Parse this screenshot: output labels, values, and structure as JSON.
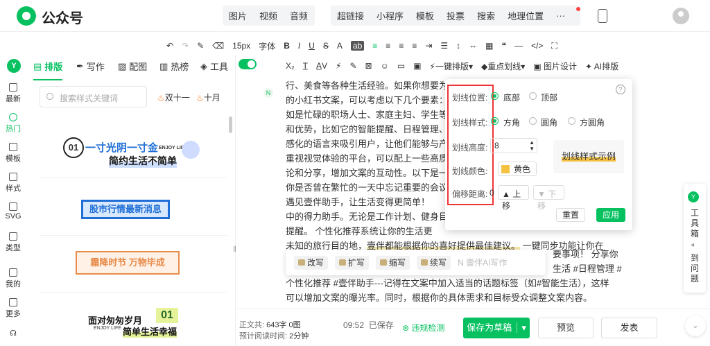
{
  "brand": {
    "title": "公众号"
  },
  "top_nav": {
    "group1": [
      "图片",
      "视频",
      "音频"
    ],
    "group2": [
      "超链接",
      "小程序",
      "模板",
      "投票",
      "搜索",
      "地理位置",
      "···"
    ]
  },
  "toolbar1": [
    "15px",
    "字体",
    "B",
    "I",
    "U",
    "S",
    "A",
    "ab",
    "≡",
    "A",
    "¶",
    "</>"
  ],
  "toolbar2": {
    "oneclick": "一键排版",
    "underline": "重点划线",
    "image_design": "图片设计",
    "ai": "AI排版"
  },
  "left_panel": {
    "tabs": [
      "排版",
      "写作",
      "配图",
      "热榜",
      "工具"
    ],
    "search_placeholder": "搜索样式关键词",
    "hot_tags": [
      "双十一",
      "十月"
    ],
    "templates": {
      "t1": {
        "num": "01",
        "main": "一寸光阴一寸金",
        "sub": "简约生活不简单",
        "tag": "ENJOY LIFE"
      },
      "t2": {
        "text": "股市行情最新消息"
      },
      "t3": {
        "text": "霜降时节 万物毕成"
      },
      "t4": {
        "main": "面对匆匆岁月",
        "num": "01",
        "sub": "简单生活幸福",
        "tag": "ENJOY LIFE"
      }
    }
  },
  "sidebar": [
    {
      "label": "最新"
    },
    {
      "label": "热门"
    },
    {
      "label": "模板"
    },
    {
      "label": "样式"
    },
    {
      "label": "SVG"
    },
    {
      "label": "类型"
    },
    {
      "label": "我的"
    },
    {
      "label": "更多"
    }
  ],
  "editor": {
    "lines": [
      "行、美食等各种生活经验。如果你想要为",
      "的小红书文案，可以考虑以下几个要素：",
      "如是忙碌的职场人士、家庭主妇、学生等",
      "和优势，比如它的智能提醒、日程管理、",
      "感化的语言来吸引用户，让他们能够与产",
      "重视视觉体验的平台，可以配上一些高质",
      "论和分享，增加文案的互动性。以下是一",
      "你是否曾在繁忙的一天中忘记重要的会议",
      "遇见壹伴助手，让生活变得更简单！",
      "中的得力助手。无论是工作计划、健身目",
      "提醒。 个性化推荐系统让你的生活更"
    ],
    "line12_pre": "未知的旅行目的地，",
    "line12_hl": "壹伴都能根据你的喜好提供最佳建议。",
    "line12_post": " 一键同步功能让你在",
    "line13": "要事项！ 分享你",
    "line14": "生活 #日程管理 #",
    "line15": "个性化推荐 #壹伴助手---记得在文案中加入适当的话题标签（如#智能生活），这样",
    "line16": "可以增加文案的曝光率。同时，根据你的具体需求和目标受众调整文案内容。"
  },
  "ai_bar": [
    "改写",
    "扩写",
    "缩写",
    "续写",
    "壹伴AI写作"
  ],
  "underline_popup": {
    "position": {
      "label": "划线位置:",
      "options": [
        "底部",
        "顶部"
      ],
      "selected": 0
    },
    "style": {
      "label": "划线样式:",
      "options": [
        "方角",
        "圆角",
        "方圆角"
      ],
      "selected": 0
    },
    "height": {
      "label": "划线高度:",
      "value": "8"
    },
    "color": {
      "label": "划线颜色:",
      "value": "黄色",
      "swatch": "#f5c142"
    },
    "offset": {
      "label": "偏移距离:",
      "value": "0",
      "up": "上移",
      "down": "下移"
    },
    "preview": "划线样式示例",
    "cancel": "重置",
    "apply": "应用"
  },
  "footer": {
    "wordcount_label": "正文共:",
    "wordcount": "643字 0图",
    "readtime_label": "预计阅读时间:",
    "readtime": "2分钟",
    "saved_time": "09:52",
    "saved_label": "已保存",
    "check": "违规检测",
    "save_draft": "保存为草稿",
    "preview": "预览",
    "publish": "发表"
  },
  "right_tools": {
    "text": "工具箱",
    "text2": "到问题"
  },
  "colors": {
    "accent": "#07c160",
    "highlight": "#f5c142",
    "danger": "#e33"
  }
}
